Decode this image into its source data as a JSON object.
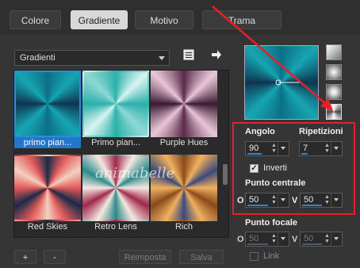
{
  "tabs": [
    {
      "label": "Colore"
    },
    {
      "label": "Gradiente"
    },
    {
      "label": "Motivo"
    },
    {
      "label": "Trama"
    }
  ],
  "gradient_dropdown": {
    "value": "Gradienti"
  },
  "gallery": {
    "items": [
      {
        "label": "primo pian...",
        "selected": true
      },
      {
        "label": "Primo pian..."
      },
      {
        "label": "Purple Hues"
      },
      {
        "label": "Red Skies"
      },
      {
        "label": "Retro Lens"
      },
      {
        "label": "Rich"
      }
    ],
    "watermark": "animabelle"
  },
  "buttons": {
    "add": "+",
    "remove": "-",
    "reset": "Reimposta",
    "save": "Salva"
  },
  "params": {
    "angle_label": "Angolo",
    "angle_value": "90",
    "repeat_label": "Ripetizioni",
    "repeat_value": "7",
    "invert_label": "Inverti",
    "invert_checked": true,
    "center_label": "Punto centrale",
    "center_h_label": "O",
    "center_h_value": "50",
    "center_v_label": "V",
    "center_v_value": "50",
    "focal_label": "Punto focale",
    "focal_h_label": "O",
    "focal_h_value": "50",
    "focal_v_label": "V",
    "focal_v_value": "50",
    "link_label": "Link",
    "link_checked": false
  },
  "colors": {
    "accent": "#2277cc",
    "highlight": "#e4202a",
    "arrow": "#e4202a"
  }
}
